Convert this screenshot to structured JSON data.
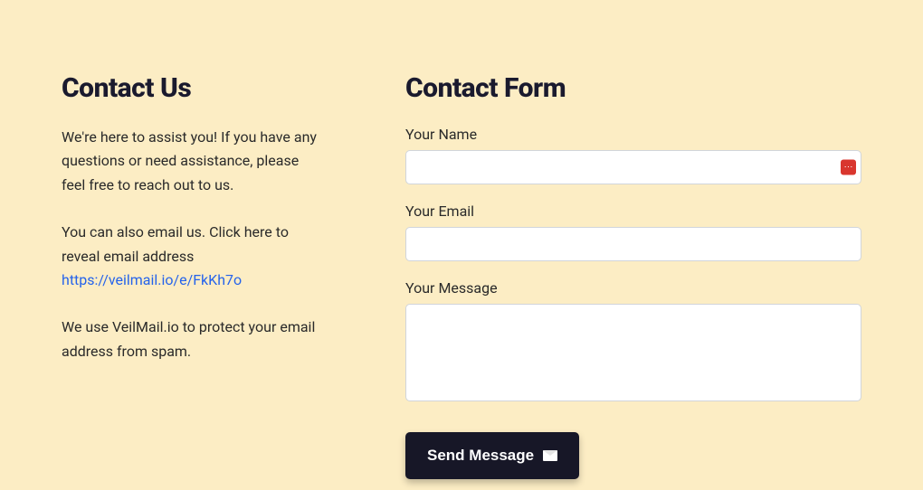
{
  "left": {
    "heading": "Contact Us",
    "para1": "We're here to assist you! If you have any questions or need assistance, please feel free to reach out to us.",
    "para2_prefix": "You can also email us. Click here to reveal email address ",
    "link_text": "https://veilmail.io/e/FkKh7o",
    "para3": "We use VeilMail.io to protect your email address from spam."
  },
  "form": {
    "heading": "Contact Form",
    "name_label": "Your Name",
    "name_value": "",
    "email_label": "Your Email",
    "email_value": "",
    "message_label": "Your Message",
    "message_value": "",
    "submit_label": "Send Message",
    "badge_glyph": "⋯"
  }
}
